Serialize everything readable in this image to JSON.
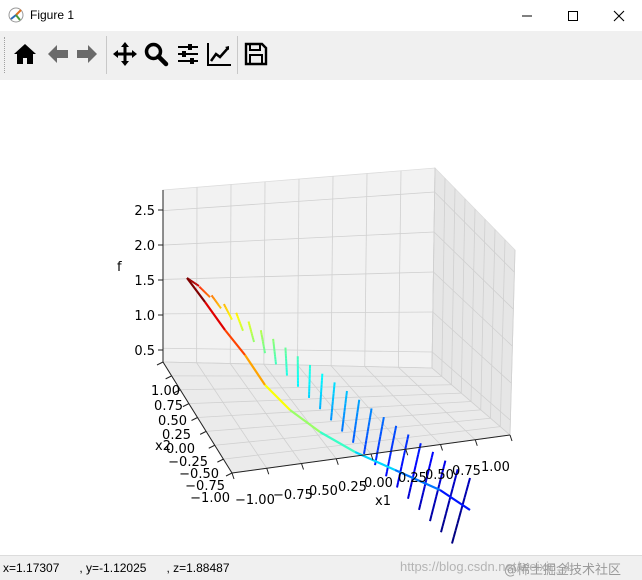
{
  "window": {
    "title": "Figure 1",
    "app_icon": "matplotlib-icon",
    "controls": [
      "minimize-icon",
      "maximize-icon",
      "close-icon"
    ]
  },
  "toolbar": {
    "tools": [
      {
        "name": "home",
        "icon": "home-icon"
      },
      {
        "name": "back",
        "icon": "arrow-left-icon"
      },
      {
        "name": "forward",
        "icon": "arrow-right-icon"
      },
      {
        "name": "pan",
        "icon": "move-icon"
      },
      {
        "name": "zoom",
        "icon": "magnifier-icon"
      },
      {
        "name": "subplots",
        "icon": "sliders-icon"
      },
      {
        "name": "customize",
        "icon": "line-chart-icon"
      },
      {
        "name": "save",
        "icon": "floppy-icon"
      }
    ]
  },
  "plot": {
    "zlabel": "f",
    "x2label": "x2",
    "x1label": "x1",
    "z_ticks": [
      "0.5",
      "1.0",
      "1.5",
      "2.0",
      "2.5"
    ],
    "x2_ticks": [
      "1.00",
      "0.75",
      "0.50",
      "0.25",
      "0.00",
      "−0.25",
      "−0.50",
      "−0.75",
      "−1.00"
    ],
    "x1_ticks": [
      "−1.00",
      "−0.75",
      "0.50",
      "0.25",
      "0.00",
      "0.25",
      "0.50",
      "0.75",
      "1.00"
    ],
    "colormap": "jet"
  },
  "chart_data": {
    "type": "line",
    "kind": "3d-surface-wireframe",
    "xlabel": "x1",
    "ylabel": "x2",
    "zlabel": "f",
    "xlim": [
      -1.0,
      1.0
    ],
    "ylim": [
      -1.0,
      1.0
    ],
    "zlim": [
      0.3,
      2.8
    ],
    "grid": true,
    "colormap": "jet",
    "z_range_shown": [
      0.3,
      2.75
    ]
  },
  "status": {
    "coords": "x=1.17307      , y=-1.12025      , z=1.88487",
    "watermark": "https://blog.csdn.net/weixin_4...",
    "watermark_right": "@稀土掘金技术社区"
  }
}
